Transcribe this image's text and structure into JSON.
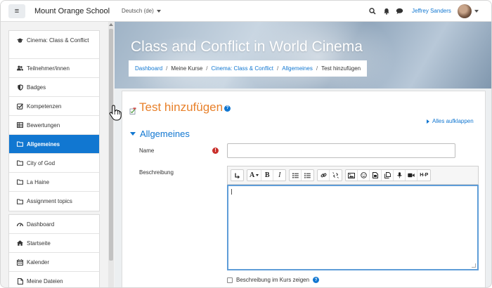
{
  "header": {
    "site_name": "Mount Orange School",
    "language": "Deutsch (de)",
    "user_name": "Jeffrey Sanders"
  },
  "sidebar": {
    "course_items": [
      {
        "label": "Cinema: Class & Conflict",
        "icon": "graduation-cap-icon"
      },
      {
        "label": "Teilnehmer/innen",
        "icon": "users-icon"
      },
      {
        "label": "Badges",
        "icon": "shield-icon"
      },
      {
        "label": "Kompetenzen",
        "icon": "checkbox-icon"
      },
      {
        "label": "Bewertungen",
        "icon": "table-icon"
      },
      {
        "label": "Allgemeines",
        "icon": "folder-icon",
        "active": true
      },
      {
        "label": "City of God",
        "icon": "folder-icon"
      },
      {
        "label": "La Haine",
        "icon": "folder-icon"
      },
      {
        "label": "Assignment topics",
        "icon": "folder-icon"
      }
    ],
    "site_items": [
      {
        "label": "Dashboard",
        "icon": "dashboard-icon"
      },
      {
        "label": "Startseite",
        "icon": "home-icon"
      },
      {
        "label": "Kalender",
        "icon": "calendar-icon"
      },
      {
        "label": "Meine Dateien",
        "icon": "file-icon"
      }
    ]
  },
  "page": {
    "course_title": "Class and Conflict in World Cinema",
    "breadcrumb": [
      "Dashboard",
      "Meine Kurse",
      "Cinema: Class & Conflict",
      "Allgemeines",
      "Test hinzufügen"
    ]
  },
  "form": {
    "heading": "Test hinzufügen",
    "expand_all": "Alles aufklappen",
    "section": "Allgemeines",
    "name_label": "Name",
    "name_value": "",
    "description_label": "Beschreibung",
    "description_value": "",
    "show_description_label": "Beschreibung im Kurs zeigen",
    "show_description_checked": false
  },
  "toolbar": {
    "buttons": [
      "collapse",
      "font-style",
      "bold",
      "italic",
      "unordered-list",
      "ordered-list",
      "link",
      "unlink",
      "image",
      "emoticon",
      "media",
      "manage-files",
      "record-audio",
      "record-video",
      "h5p"
    ],
    "italic_label": "I",
    "bold_label": "B",
    "h5p_label": "H-P"
  },
  "colors": {
    "accent": "#1177d1",
    "heading": "#e8812b",
    "required": "#c9302c"
  }
}
